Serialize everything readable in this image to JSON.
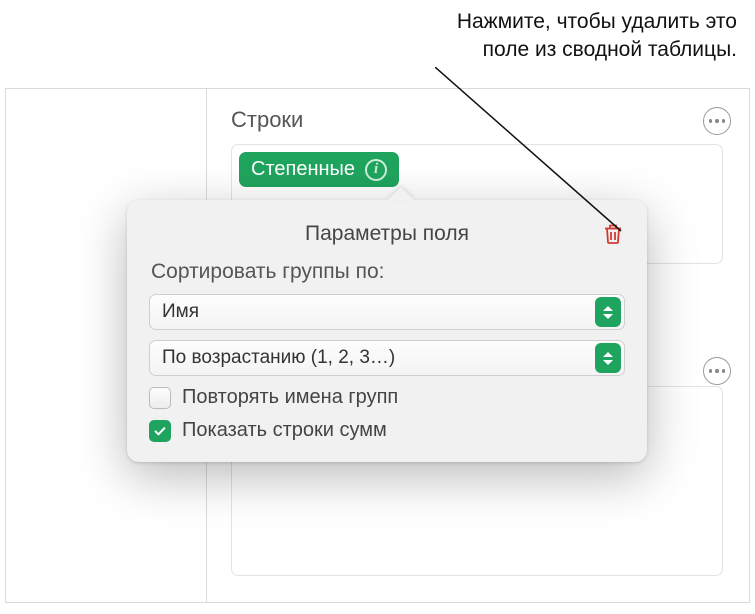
{
  "callout": {
    "line1": "Нажмите, чтобы удалить это",
    "line2": "поле из сводной таблицы."
  },
  "section": {
    "title": "Строки"
  },
  "chip": {
    "label": "Степенные"
  },
  "popover": {
    "title": "Параметры поля",
    "sort_label": "Сортировать группы по:",
    "sort_by": "Имя",
    "sort_order": "По возрастанию (1, 2, 3…)",
    "repeat_label": "Повторять имена групп",
    "show_totals_label": "Показать строки сумм",
    "repeat_checked": false,
    "show_totals_checked": true
  },
  "icons": {
    "more": "more-icon",
    "info": "info-icon",
    "trash": "trash-icon",
    "check": "check-icon"
  }
}
